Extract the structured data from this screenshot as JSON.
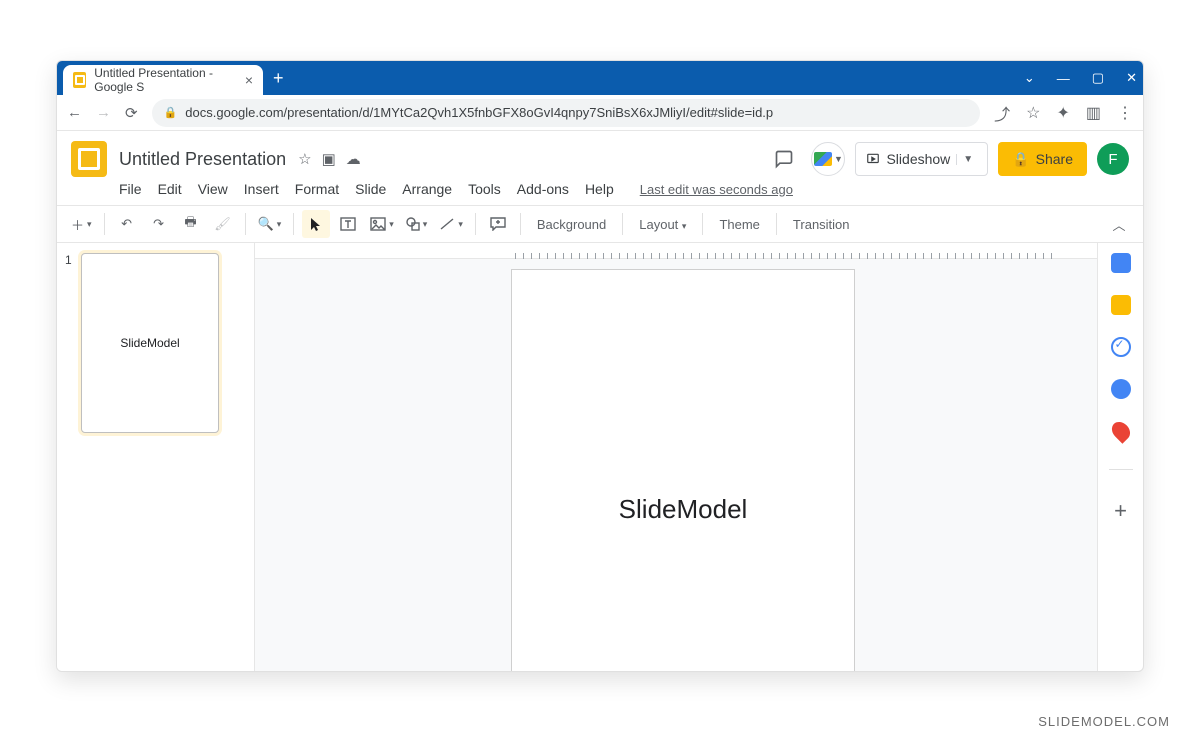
{
  "browser": {
    "tab_title": "Untitled Presentation - Google S",
    "url": "docs.google.com/presentation/d/1MYtCa2Qvh1X5fnbGFX8oGvI4qnpy7SniBsX6xJMliyI/edit#slide=id.p"
  },
  "header": {
    "doc_title": "Untitled Presentation",
    "slideshow_label": "Slideshow",
    "share_label": "Share",
    "avatar_letter": "F"
  },
  "menu": {
    "items": [
      "File",
      "Edit",
      "View",
      "Insert",
      "Format",
      "Slide",
      "Arrange",
      "Tools",
      "Add-ons",
      "Help"
    ],
    "last_edit": "Last edit was seconds ago"
  },
  "toolbar": {
    "background": "Background",
    "layout": "Layout",
    "theme": "Theme",
    "transition": "Transition"
  },
  "thumbnails": {
    "items": [
      {
        "number": "1",
        "text": "SlideModel"
      }
    ]
  },
  "canvas": {
    "slide_text": "SlideModel"
  },
  "watermark": "SLIDEMODEL.COM"
}
